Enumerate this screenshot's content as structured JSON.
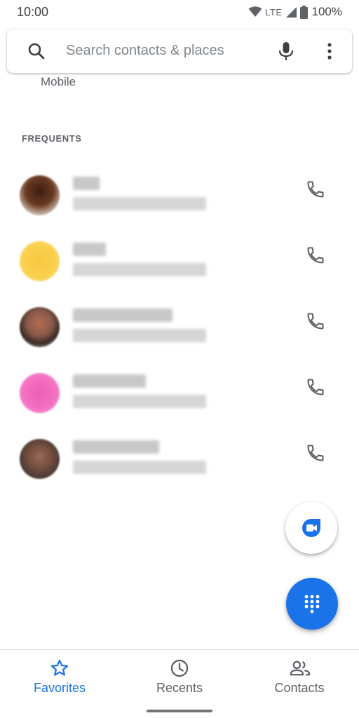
{
  "status_bar": {
    "time": "10:00",
    "network": "LTE",
    "battery": "100%"
  },
  "search": {
    "placeholder": "Search contacts & places"
  },
  "mobile_label": "Mobile",
  "frequents": {
    "header": "FREQUENTS",
    "contacts": [
      {
        "name": "",
        "detail": "",
        "avatar_color": "#6b3a22"
      },
      {
        "name": "",
        "detail": "",
        "avatar_color": "#f9cf4c"
      },
      {
        "name": "",
        "detail": "",
        "avatar_color": "#8a5a4a"
      },
      {
        "name": "",
        "detail": "",
        "avatar_color": "#f36fc0"
      },
      {
        "name": "",
        "detail": "",
        "avatar_color": "#6d4a3c"
      }
    ]
  },
  "bottom_nav": {
    "items": [
      {
        "label": "Favorites",
        "icon": "star-icon",
        "active": true
      },
      {
        "label": "Recents",
        "icon": "clock-icon",
        "active": false
      },
      {
        "label": "Contacts",
        "icon": "people-icon",
        "active": false
      }
    ]
  },
  "colors": {
    "accent": "#1a73e8",
    "icon_gray": "#5f6368",
    "text_gray": "#5f6368"
  }
}
